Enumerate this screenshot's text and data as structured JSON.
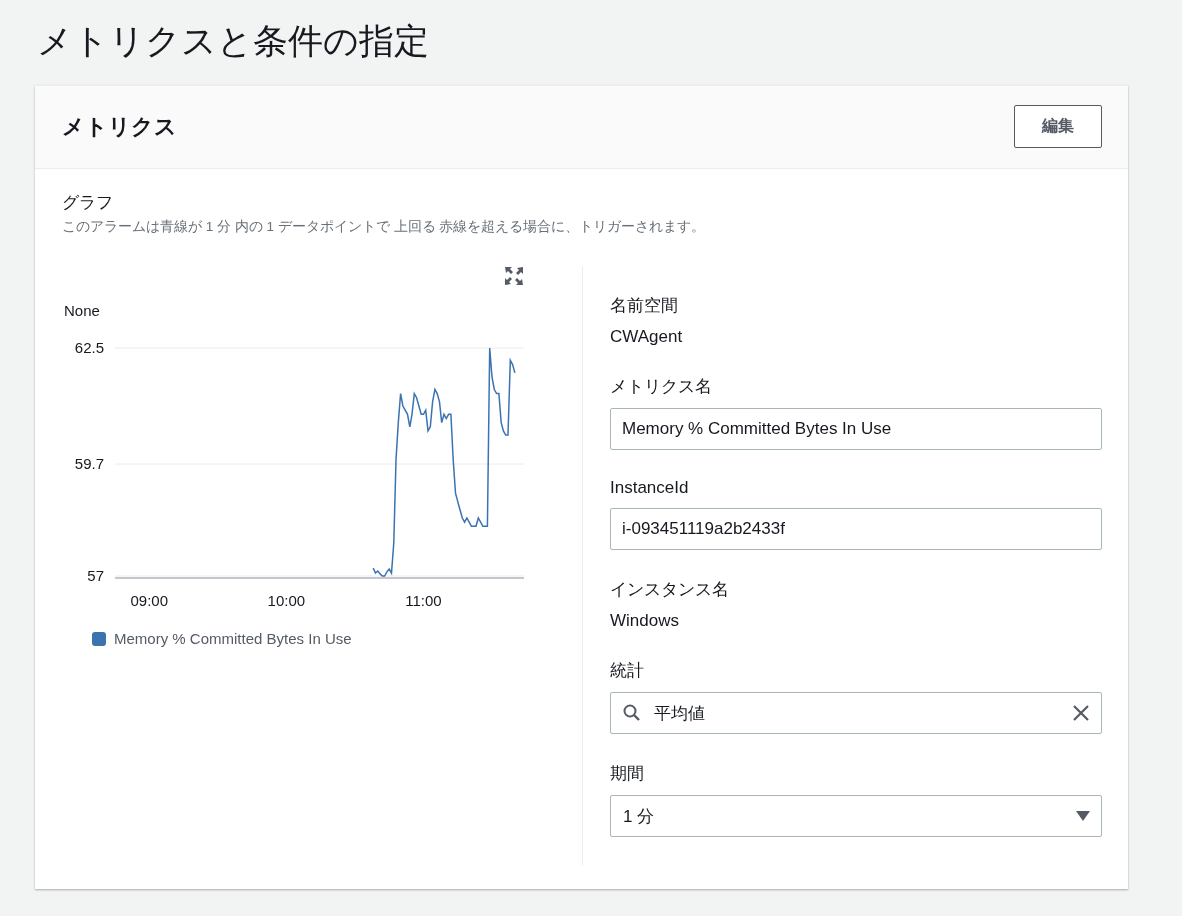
{
  "page_title": "メトリクスと条件の指定",
  "panel": {
    "title": "メトリクス",
    "edit_button": "編集"
  },
  "graph": {
    "heading": "グラフ",
    "description": "このアラームは青線が 1 分 内の 1 データポイントで 上回る 赤線を超える場合に、トリガーされます。",
    "chart_data": {
      "type": "line",
      "ylabel": "None",
      "xlim": [
        525,
        704
      ],
      "ylim": [
        57,
        62.5
      ],
      "yticks": [
        57,
        59.7,
        62.5
      ],
      "xticks": [
        {
          "value": 540,
          "label": "09:00"
        },
        {
          "value": 600,
          "label": "10:00"
        },
        {
          "value": 660,
          "label": "11:00"
        }
      ],
      "x": [
        638,
        639,
        640,
        641,
        642,
        643,
        644,
        645,
        646,
        647,
        648,
        649,
        650,
        651,
        652,
        653,
        654,
        655,
        656,
        657,
        658,
        659,
        660,
        661,
        662,
        663,
        664,
        665,
        666,
        667,
        668,
        669,
        670,
        671,
        672,
        673,
        674,
        675,
        676,
        677,
        678,
        679,
        680,
        681,
        682,
        683,
        684,
        685,
        686,
        687,
        688,
        689,
        690,
        691,
        692,
        693,
        694,
        695,
        696,
        697,
        698,
        699,
        700
      ],
      "series": [
        {
          "name": "Memory % Committed Bytes In Use",
          "color": "#3b73b0",
          "values": [
            57.19,
            57.07,
            57.12,
            57.05,
            57.0,
            57.0,
            57.1,
            57.17,
            57.07,
            57.8,
            59.8,
            60.7,
            61.4,
            61.1,
            61.0,
            60.9,
            60.6,
            60.9,
            61.4,
            61.3,
            61.1,
            60.9,
            60.9,
            61.0,
            60.5,
            60.6,
            61.2,
            61.5,
            61.4,
            61.2,
            60.7,
            60.9,
            60.8,
            60.9,
            60.9,
            59.8,
            59.0,
            58.8,
            58.6,
            58.4,
            58.3,
            58.4,
            58.3,
            58.2,
            58.2,
            58.2,
            58.4,
            58.3,
            58.2,
            58.2,
            58.2,
            62.5,
            61.8,
            61.5,
            61.4,
            61.4,
            60.7,
            60.5,
            60.4,
            60.4,
            62.2,
            62.1,
            61.9
          ]
        }
      ]
    }
  },
  "details": [
    {
      "kind": "text",
      "label": "名前空間",
      "value": "CWAgent"
    },
    {
      "kind": "input",
      "label": "メトリクス名",
      "value": "Memory % Committed Bytes In Use"
    },
    {
      "kind": "input",
      "label": "InstanceId",
      "value": "i-093451119a2b2433f"
    },
    {
      "kind": "text",
      "label": "インスタンス名",
      "value": "Windows"
    },
    {
      "kind": "search",
      "label": "統計",
      "value": "平均値"
    },
    {
      "kind": "select",
      "label": "期間",
      "value": "1 分"
    }
  ]
}
